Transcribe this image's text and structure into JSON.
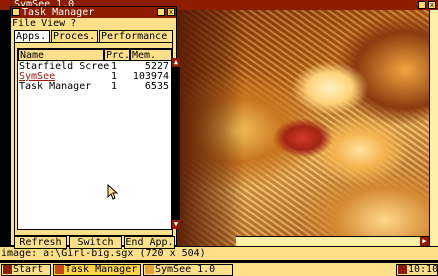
{
  "symsee": {
    "title": "SymSee 1.0",
    "image_status": "image: a:\\Girl-big.sgx (720 x 504)"
  },
  "task_manager": {
    "title": "Task Manager",
    "menu": [
      "File",
      "View",
      "?"
    ],
    "tabs": [
      "Apps.",
      "Proces.",
      "Performance"
    ],
    "columns": [
      "Name",
      "Prc.",
      "Mem."
    ],
    "rows": [
      {
        "name": "Starfield Scree",
        "prc": "1",
        "mem": "5227"
      },
      {
        "name": "SymSee",
        "prc": "1",
        "mem": "103974"
      },
      {
        "name": "Task Manager",
        "prc": "1",
        "mem": "6535"
      }
    ],
    "buttons": {
      "refresh": "Refresh",
      "switch": "Switch",
      "end": "End App."
    }
  },
  "taskbar": {
    "start": "Start",
    "items": [
      "Task Manager",
      "SymSee 1.0"
    ],
    "clock": "10:10"
  },
  "colors": {
    "title_bar": "#8e1d00",
    "window_bg": "#ffe08a",
    "selection": "#a11a0f"
  }
}
